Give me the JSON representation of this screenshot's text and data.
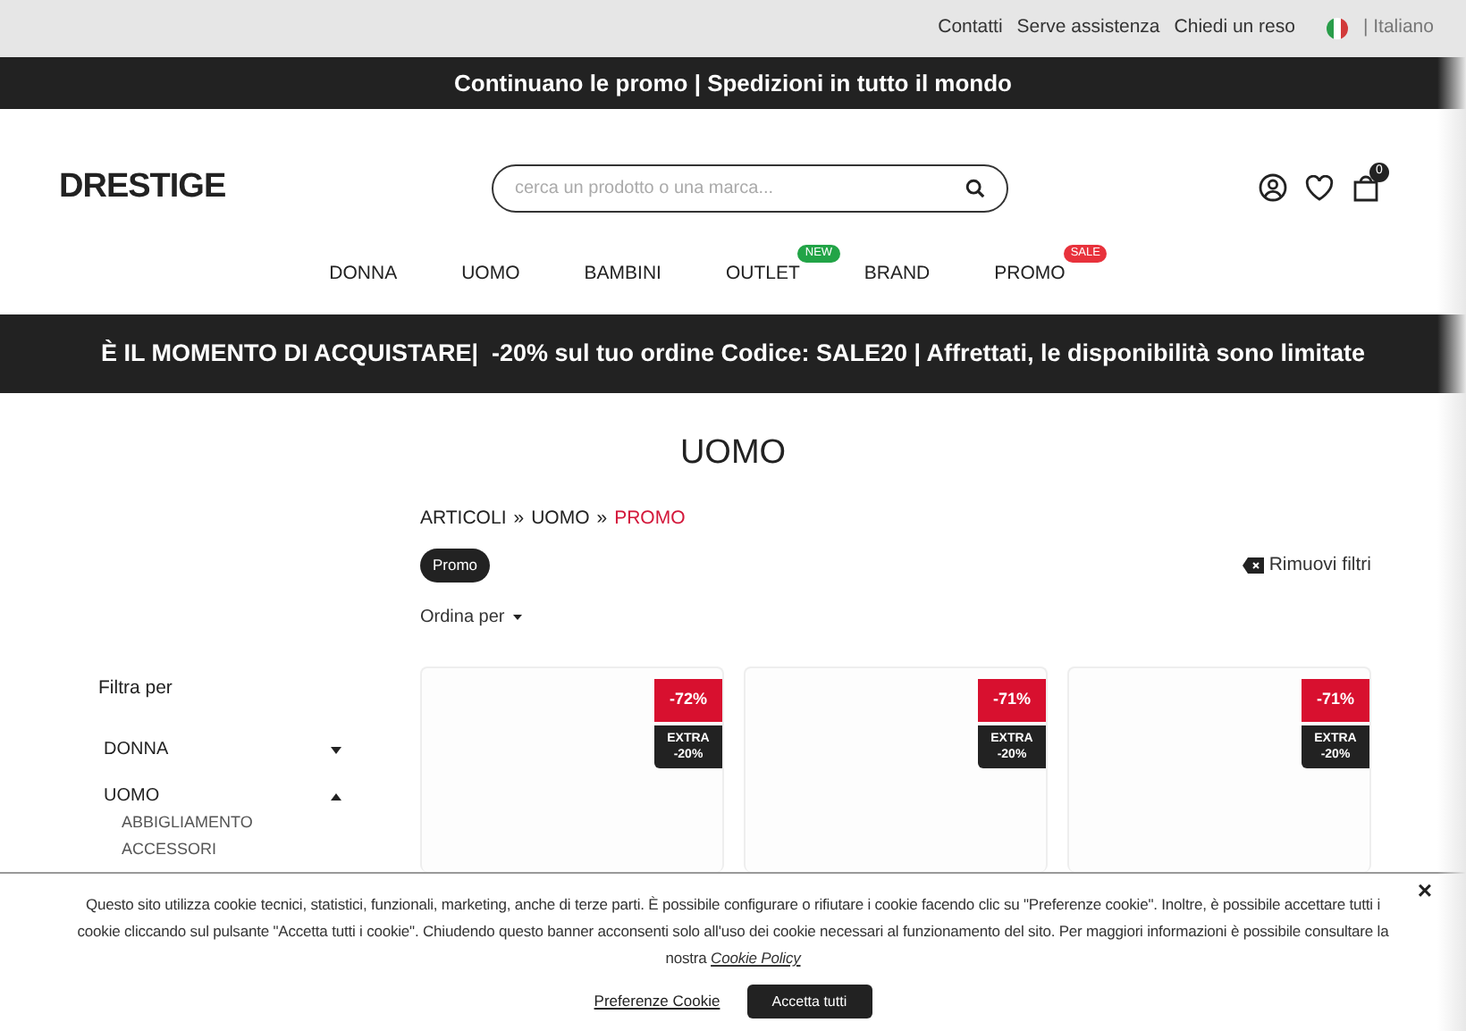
{
  "top_links": [
    "Contatti",
    "Serve assistenza",
    "Chiedi un reso"
  ],
  "language": "| Italiano",
  "announcement": "Continuano le promo | Spedizioni in tutto il mondo",
  "logo": "DRESTIGE",
  "search": {
    "placeholder": "cerca un prodotto o una marca..."
  },
  "cart_count": "0",
  "nav": [
    {
      "label": "DONNA"
    },
    {
      "label": "UOMO"
    },
    {
      "label": "BAMBINI"
    },
    {
      "label": "OUTLET",
      "badge": "NEW",
      "color": "#22a447"
    },
    {
      "label": "BRAND"
    },
    {
      "label": "PROMO",
      "badge": "SALE",
      "color": "#e8323c"
    }
  ],
  "promo_banner": "È IL MOMENTO DI ACQUISTARE|  -20% sul tuo ordine Codice: SALE20 | Affrettati, le disponibilità sono limitate",
  "page_title": "UOMO",
  "breadcrumb": [
    {
      "label": "ARTICOLI",
      "current": false
    },
    {
      "label": "UOMO",
      "current": false
    },
    {
      "label": "PROMO",
      "current": true
    }
  ],
  "breadcrumb_separator": "»",
  "active_filter": "Promo",
  "remove_filters": "Rimuovi filtri",
  "sort": "Ordina per",
  "filters": {
    "title": "Filtra per",
    "groups": [
      {
        "label": "DONNA",
        "expanded": false
      },
      {
        "label": "UOMO",
        "expanded": true,
        "children": [
          "ABBIGLIAMENTO",
          "ACCESSORI"
        ]
      }
    ]
  },
  "products": [
    {
      "discount": "-72%",
      "extra": [
        "EXTRA",
        "-20%"
      ]
    },
    {
      "discount": "-71%",
      "extra": [
        "EXTRA",
        "-20%"
      ]
    },
    {
      "discount": "-71%",
      "extra": [
        "EXTRA",
        "-20%"
      ]
    }
  ],
  "cookie": {
    "text": "Questo sito utilizza cookie tecnici, statistici, funzionali, marketing, anche di terze parti. È possibile configurare o rifiutare i cookie facendo clic su \"Preferenze cookie\". Inoltre, è possibile accettare tutti i cookie cliccando sul pulsante \"Accetta tutti i cookie\". Chiudendo questo banner acconsenti solo all'uso dei cookie necessari al funzionamento del sito. Per maggiori informazioni è possibile consultare la nostra",
    "link": "Cookie Policy",
    "preferences": "Preferenze Cookie",
    "accept": "Accetta tutti",
    "close": "×"
  }
}
